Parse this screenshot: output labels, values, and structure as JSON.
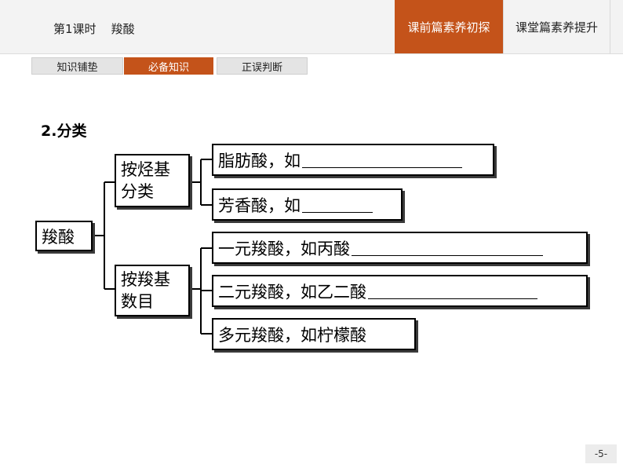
{
  "header": {
    "lesson_title": "第1课时    羧酸",
    "nav": [
      "课前篇素养初探",
      "课堂篇素养提升"
    ]
  },
  "subtabs": [
    "知识铺垫",
    "必备知识",
    "正误判断"
  ],
  "section_title": "2.分类",
  "diagram": {
    "root": "羧酸",
    "group1": {
      "label_line1": "按烃基",
      "label_line2": "分类"
    },
    "group1_items": [
      "脂肪酸，如",
      "芳香酸，如"
    ],
    "group2": {
      "label_line1": "按羧基",
      "label_line2": "数目"
    },
    "group2_items": [
      "一元羧酸，如丙酸",
      "二元羧酸，如乙二酸",
      "多元羧酸，如柠檬酸"
    ]
  },
  "page_number": "-5-"
}
